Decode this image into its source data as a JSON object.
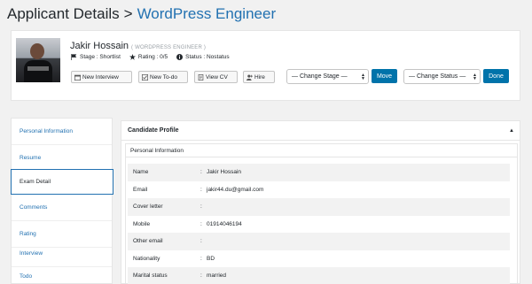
{
  "header": {
    "title": "Applicant Details",
    "separator": ">",
    "crumb": "WordPress Engineer"
  },
  "candidate": {
    "name": "Jakir Hossain",
    "job": "( WORDPRESS ENGINEER )",
    "stage": "Stage : Shortlist",
    "rating": "Rating : 0/5",
    "status": "Status : Nostatus"
  },
  "actions": {
    "new_interview": "New Interview",
    "new_todo": "New To-do",
    "view_cv": "View CV",
    "hire": "Hire",
    "change_stage": "— Change Stage —",
    "move": "Move",
    "change_status": "— Change Status —",
    "done": "Done"
  },
  "nav": {
    "items": [
      {
        "label": "Personal Information"
      },
      {
        "label": "Resume"
      },
      {
        "label": "Exam Detail"
      },
      {
        "label": "Comments"
      },
      {
        "label": "Rating"
      },
      {
        "label": "Interview"
      },
      {
        "label": "Todo"
      }
    ],
    "active": "Exam Detail"
  },
  "profile": {
    "title": "Candidate Profile",
    "section": "Personal Information",
    "rows": [
      {
        "key": "Name",
        "value": "Jakir Hossain"
      },
      {
        "key": "Email",
        "value": "jakir44.du@gmail.com"
      },
      {
        "key": "Cover letter",
        "value": ""
      },
      {
        "key": "Mobile",
        "value": "01914046194"
      },
      {
        "key": "Other email",
        "value": ""
      },
      {
        "key": "Nationality",
        "value": "BD"
      },
      {
        "key": "Marital status",
        "value": "married"
      }
    ]
  },
  "colors": {
    "link": "#2271b1",
    "primary_button": "#0073aa",
    "background": "#f1f1f1"
  }
}
